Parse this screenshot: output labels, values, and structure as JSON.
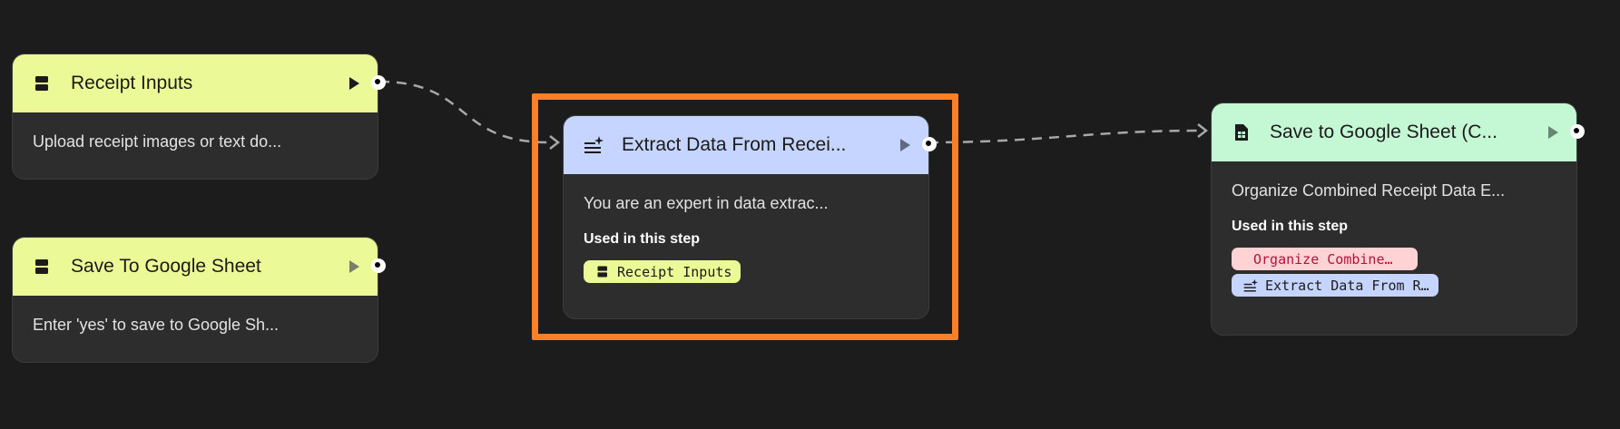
{
  "colors": {
    "background": "#1c1c1c",
    "input_header": "#ebfa96",
    "generate_header": "#c5d5ff",
    "output_header": "#c4f8d5",
    "selection": "#ff7f27",
    "chip_red": "#ffd3d3",
    "chip_red_text": "#b3123e"
  },
  "nodes": {
    "receipt_inputs": {
      "title": "Receipt Inputs",
      "icon": "input-icon",
      "description": "Upload receipt images or text do..."
    },
    "save_to_sheet_input": {
      "title": "Save To Google Sheet",
      "icon": "input-icon",
      "description": "Enter 'yes' to save to Google Sh..."
    },
    "extract": {
      "title": "Extract Data From Recei...",
      "icon": "generate-icon",
      "description": "You are an expert in data extrac...",
      "used_label": "Used in this step",
      "chips": [
        {
          "label": "Receipt Inputs",
          "icon": "input-icon"
        }
      ]
    },
    "save_output": {
      "title": "Save to Google Sheet (C...",
      "icon": "sheet-icon",
      "description": "Organize Combined Receipt Data E...",
      "used_label": "Used in this step",
      "chips": [
        {
          "label": "Organize Combine…",
          "icon": ""
        },
        {
          "label": "Extract Data From R…",
          "icon": "generate-icon"
        }
      ]
    }
  }
}
